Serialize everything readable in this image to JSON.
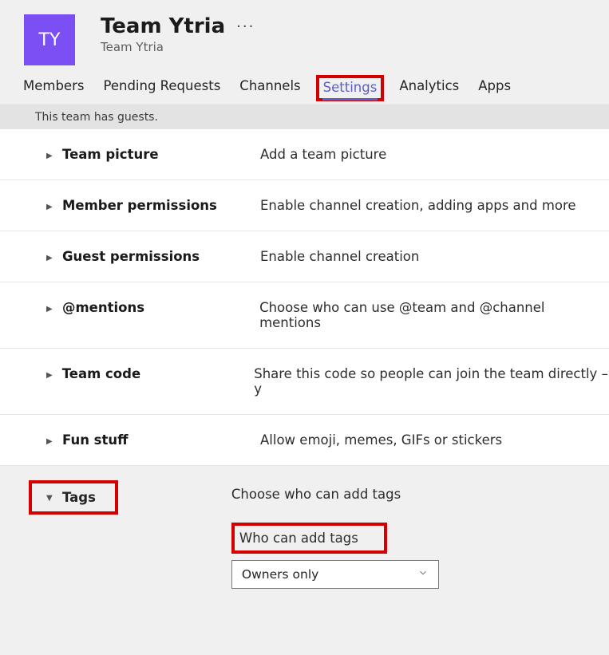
{
  "header": {
    "avatar_initials": "TY",
    "title": "Team Ytria",
    "subtitle": "Team Ytria",
    "more_glyph": "···"
  },
  "tabs": [
    {
      "label": "Members"
    },
    {
      "label": "Pending Requests"
    },
    {
      "label": "Channels"
    },
    {
      "label": "Settings",
      "active": true
    },
    {
      "label": "Analytics"
    },
    {
      "label": "Apps"
    }
  ],
  "banner": "This team has guests.",
  "sections": [
    {
      "title": "Team picture",
      "desc": "Add a team picture"
    },
    {
      "title": "Member permissions",
      "desc": "Enable channel creation, adding apps and more"
    },
    {
      "title": "Guest permissions",
      "desc": "Enable channel creation"
    },
    {
      "title": "@mentions",
      "desc": "Choose who can use @team and @channel mentions"
    },
    {
      "title": "Team code",
      "desc": "Share this code so people can join the team directly – y"
    },
    {
      "title": "Fun stuff",
      "desc": "Allow emoji, memes, GIFs or stickers"
    }
  ],
  "tags": {
    "title": "Tags",
    "desc": "Choose who can add tags",
    "sub_label": "Who can add tags",
    "selected": "Owners only"
  },
  "glyphs": {
    "chev_right": "▶",
    "chev_down": "▼",
    "chev_select": "⌄"
  }
}
